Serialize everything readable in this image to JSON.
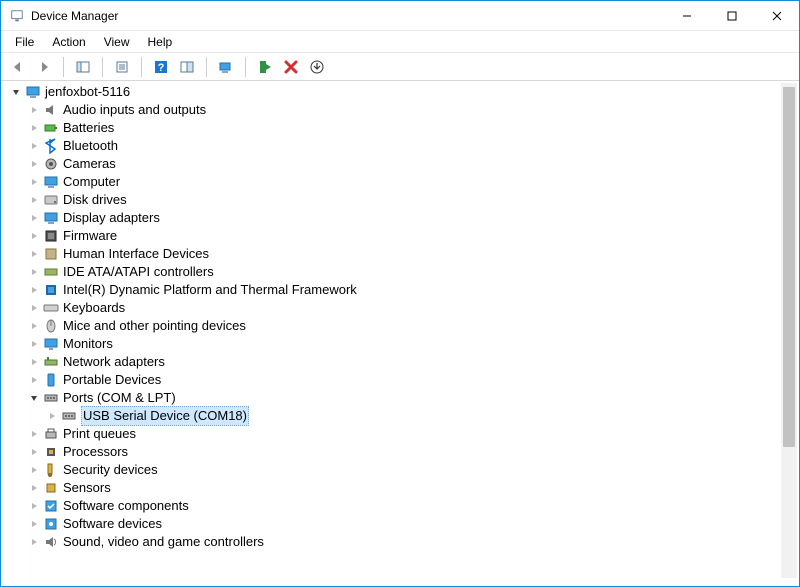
{
  "window": {
    "title": "Device Manager"
  },
  "menu": {
    "file": "File",
    "action": "Action",
    "view": "View",
    "help": "Help"
  },
  "tree": {
    "root": "jenfoxbot-5116",
    "items": [
      {
        "label": "Audio inputs and outputs",
        "icon": "audio"
      },
      {
        "label": "Batteries",
        "icon": "battery"
      },
      {
        "label": "Bluetooth",
        "icon": "bluetooth"
      },
      {
        "label": "Cameras",
        "icon": "camera"
      },
      {
        "label": "Computer",
        "icon": "computer"
      },
      {
        "label": "Disk drives",
        "icon": "disk"
      },
      {
        "label": "Display adapters",
        "icon": "display"
      },
      {
        "label": "Firmware",
        "icon": "firmware"
      },
      {
        "label": "Human Interface Devices",
        "icon": "hid"
      },
      {
        "label": "IDE ATA/ATAPI controllers",
        "icon": "ide"
      },
      {
        "label": "Intel(R) Dynamic Platform and Thermal Framework",
        "icon": "intel"
      },
      {
        "label": "Keyboards",
        "icon": "keyboard"
      },
      {
        "label": "Mice and other pointing devices",
        "icon": "mouse"
      },
      {
        "label": "Monitors",
        "icon": "monitor"
      },
      {
        "label": "Network adapters",
        "icon": "network"
      },
      {
        "label": "Portable Devices",
        "icon": "portable"
      },
      {
        "label": "Ports (COM & LPT)",
        "icon": "port",
        "expanded": true,
        "children": [
          {
            "label": "USB Serial Device (COM18)",
            "icon": "port",
            "selected": true
          }
        ]
      },
      {
        "label": "Print queues",
        "icon": "printer"
      },
      {
        "label": "Processors",
        "icon": "cpu"
      },
      {
        "label": "Security devices",
        "icon": "security"
      },
      {
        "label": "Sensors",
        "icon": "sensor"
      },
      {
        "label": "Software components",
        "icon": "swcomp"
      },
      {
        "label": "Software devices",
        "icon": "swdev"
      },
      {
        "label": "Sound, video and game controllers",
        "icon": "sound"
      }
    ]
  }
}
